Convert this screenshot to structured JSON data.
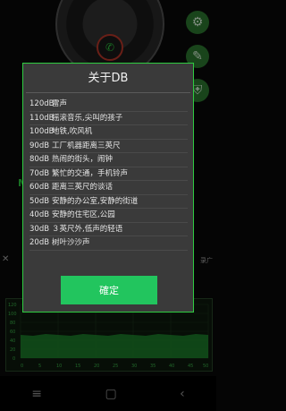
{
  "dialog": {
    "title": "关于DB",
    "confirm_label": "確定",
    "rows": [
      {
        "level": "120dB",
        "text": "雷声"
      },
      {
        "level": "110dB",
        "text": "摇滚音乐,尖叫的孩子"
      },
      {
        "level": "100dB",
        "text": "地铁,吹风机"
      },
      {
        "level": "90dB",
        "text": "工厂机器距离三英尺"
      },
      {
        "level": "80dB",
        "text": "热闹的街头，闹钟"
      },
      {
        "level": "70dB",
        "text": "繁忙的交通，手机铃声"
      },
      {
        "level": "60dB",
        "text": "距离三英尺的谈话"
      },
      {
        "level": "50dB",
        "text": "安静的办公室,安静的街道"
      },
      {
        "level": "40dB",
        "text": "安静的住宅区,公园"
      },
      {
        "level": "30dB",
        "text": "３英尺外,低声的轻语"
      },
      {
        "level": "20dB",
        "text": "树叶沙沙声"
      }
    ]
  },
  "background": {
    "gauge_icon": "phone-icon",
    "fab_top_icon": "gear-icon",
    "fab_mid_icon": "edit-icon",
    "fab_bottom_icon": "shield-icon",
    "side_letter": "M",
    "side_right_text": "录广",
    "graph_y_ticks": [
      "120",
      "100",
      "80",
      "60",
      "40",
      "20",
      "0"
    ],
    "graph_x_ticks": [
      "0",
      "5",
      "10",
      "15",
      "20",
      "25",
      "30",
      "35",
      "40",
      "45",
      "50"
    ]
  },
  "nav": {
    "menu_icon": "≡",
    "home_icon": "▢",
    "back_icon": "‹"
  },
  "colors": {
    "accent": "#22c55e",
    "dialog_bg": "#3a3a3a",
    "dialog_border": "#2ecc40"
  }
}
